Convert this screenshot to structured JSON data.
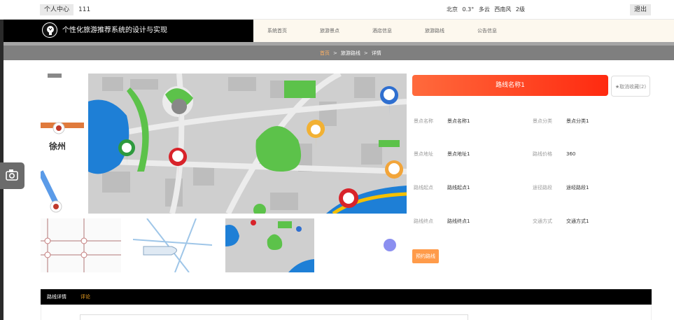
{
  "topbar": {
    "user_center": "个人中心",
    "username": "111",
    "weather": {
      "city": "北京",
      "temp": "0.3°",
      "condition": "多云",
      "wind": "西南风",
      "level": "2级"
    },
    "logout": "退出"
  },
  "brand": {
    "title": "个性化旅游推荐系统的设计与实现"
  },
  "nav": {
    "items": [
      "系统首页",
      "旅游景点",
      "酒店信息",
      "旅游路线",
      "公告信息"
    ]
  },
  "breadcrumb": {
    "home": "首页",
    "section": "旅游路线",
    "current": "详情",
    "sep": ">"
  },
  "detail": {
    "route_name": "路线名称1",
    "fav_label": "★取消收藏(2)",
    "fields": [
      {
        "label": "景点名称",
        "value": "景点名称1"
      },
      {
        "label": "景点分类",
        "value": "景点分类1"
      },
      {
        "label": "景点地址",
        "value": "景点地址1"
      },
      {
        "label": "路线价格",
        "value": "360"
      },
      {
        "label": "路线起点",
        "value": "路线起点1"
      },
      {
        "label": "途径路段",
        "value": "途经路段1"
      },
      {
        "label": "路线终点",
        "value": "路线终点1"
      },
      {
        "label": "交通方式",
        "value": "交通方式1"
      }
    ],
    "book_label": "预约路线"
  },
  "image_text": {
    "city_label": "徐州"
  },
  "tabs": [
    {
      "label": "路线详情",
      "active": false
    },
    {
      "label": "评论",
      "active": true
    }
  ],
  "colors": {
    "accent": "#ff3b1f",
    "book": "#ff9b4a",
    "comment_tab": "#f5a623",
    "breadcrumb_home": "#ffb163"
  }
}
